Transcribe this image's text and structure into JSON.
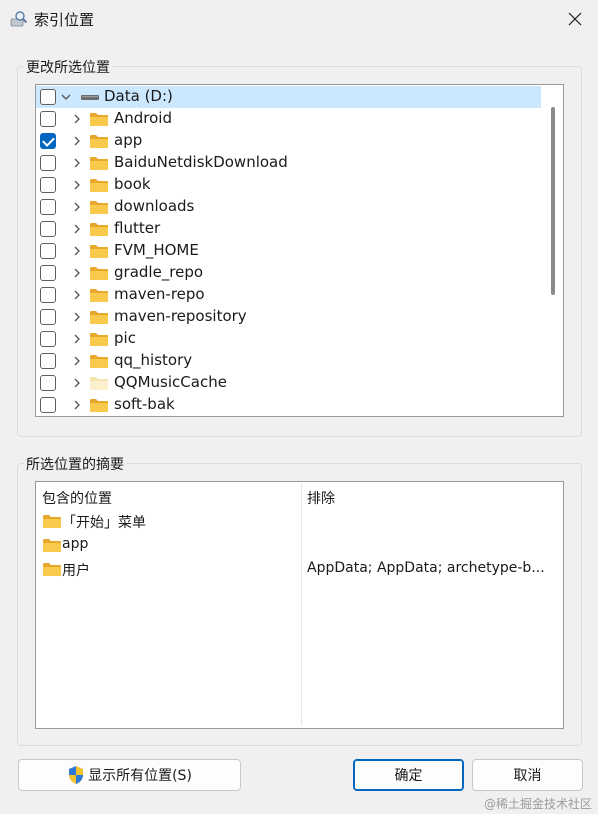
{
  "window": {
    "title": "索引位置",
    "close_glyph": "✕"
  },
  "change_group": {
    "label": "更改所选位置"
  },
  "tree": {
    "root": {
      "label": "Data (D:)",
      "checked": false,
      "expanded": true,
      "selected": true,
      "icon": "drive-icon"
    },
    "items": [
      {
        "label": "Android",
        "checked": false,
        "icon": "folder-icon"
      },
      {
        "label": "app",
        "checked": true,
        "icon": "folder-icon"
      },
      {
        "label": "BaiduNetdiskDownload",
        "checked": false,
        "icon": "folder-icon"
      },
      {
        "label": "book",
        "checked": false,
        "icon": "folder-icon"
      },
      {
        "label": "downloads",
        "checked": false,
        "icon": "folder-icon"
      },
      {
        "label": "flutter",
        "checked": false,
        "icon": "folder-icon"
      },
      {
        "label": "FVM_HOME",
        "checked": false,
        "icon": "folder-icon"
      },
      {
        "label": "gradle_repo",
        "checked": false,
        "icon": "folder-icon"
      },
      {
        "label": "maven-repo",
        "checked": false,
        "icon": "folder-icon"
      },
      {
        "label": "maven-repository",
        "checked": false,
        "icon": "folder-icon"
      },
      {
        "label": "pic",
        "checked": false,
        "icon": "folder-icon"
      },
      {
        "label": "qq_history",
        "checked": false,
        "icon": "folder-icon"
      },
      {
        "label": "QQMusicCache",
        "checked": false,
        "icon": "folder-hidden-icon"
      },
      {
        "label": "soft-bak",
        "checked": false,
        "icon": "folder-icon"
      }
    ]
  },
  "summary_group": {
    "label": "所选位置的摘要",
    "columns": {
      "included": "包含的位置",
      "excluded": "排除"
    },
    "rows": [
      {
        "included": "「开始」菜单",
        "excluded": ""
      },
      {
        "included": "app",
        "excluded": ""
      },
      {
        "included": "用户",
        "excluded": "AppData; AppData; archetype-b..."
      }
    ]
  },
  "buttons": {
    "show_all": "显示所有位置(S)",
    "ok": "确定",
    "cancel": "取消"
  },
  "watermark": "@稀土掘金技术社区",
  "colors": {
    "accent": "#0067c0",
    "selection": "#cce8ff",
    "folder": "#f8c94a",
    "window_bg": "#f0f0f0"
  }
}
